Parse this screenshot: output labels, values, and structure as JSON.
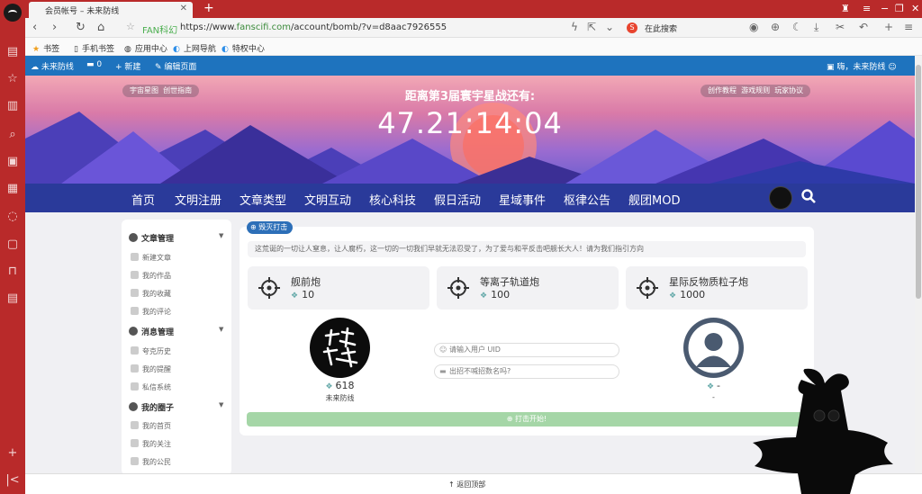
{
  "browser": {
    "tab_title": "会员帐号 – 未来防线",
    "url_label": "FAN科幻",
    "url_prefix": "https://www.",
    "url_domain": "fanscifi.com",
    "url_path": "/account/bomb/?v=d8aac7926555",
    "search_placeholder": "在此搜索",
    "bookmarks": [
      "书签",
      "手机书签",
      "应用中心",
      "上网导航",
      "特权中心"
    ]
  },
  "admin_bar": {
    "site_name": "未来防线",
    "comments": "0",
    "new": "新建",
    "edit": "编辑页面",
    "user_greeting": "嗨，未来防线"
  },
  "hero": {
    "left_pills": [
      "宇宙星图",
      "创世指南"
    ],
    "right_pills": [
      "创作教程",
      "游戏规则",
      "玩家协议"
    ],
    "countdown_title": "距离第3届寰宇星战还有:",
    "countdown": "47.21:14:04"
  },
  "nav": [
    "首页",
    "文明注册",
    "文章类型",
    "文明互动",
    "核心科技",
    "假日活动",
    "星域事件",
    "枢律公告",
    "舰团MOD"
  ],
  "sidebar": {
    "sections": [
      {
        "title": "文章管理",
        "items": [
          "新建文章",
          "我的作品",
          "我的收藏",
          "我的评论"
        ]
      },
      {
        "title": "消息管理",
        "items": [
          "夸克历史",
          "我的提醒",
          "私信系统"
        ]
      },
      {
        "title": "我的圈子",
        "items": [
          "我的首页",
          "我的关注",
          "我的公民"
        ]
      }
    ]
  },
  "bomb": {
    "badge": "毁灭打击",
    "notice": "这荒诞的一切让人窒息，让人腐朽，这一切的一切我们早就无法忍受了，为了爱与和平反击吧舰长大人！请为我们指引方向",
    "weapons": [
      {
        "name": "舰前炮",
        "cost": "10"
      },
      {
        "name": "等离子轨道炮",
        "cost": "100"
      },
      {
        "name": "星际反物质粒子炮",
        "cost": "1000"
      }
    ],
    "player": {
      "score": "618",
      "name": "未来防线"
    },
    "target": {
      "score": "-",
      "name": "-"
    },
    "uid_placeholder": "请输入用户 UID",
    "msg_placeholder": "出招不喊招数名吗?",
    "fight_label": "打击开始!"
  },
  "footer": {
    "back_to_top": "返回顶部"
  },
  "colors": {
    "admin_bar": "#1e73be",
    "nav": "#2a3a9a",
    "browser_red": "#b92a2a",
    "fight": "#a5d6a7"
  }
}
